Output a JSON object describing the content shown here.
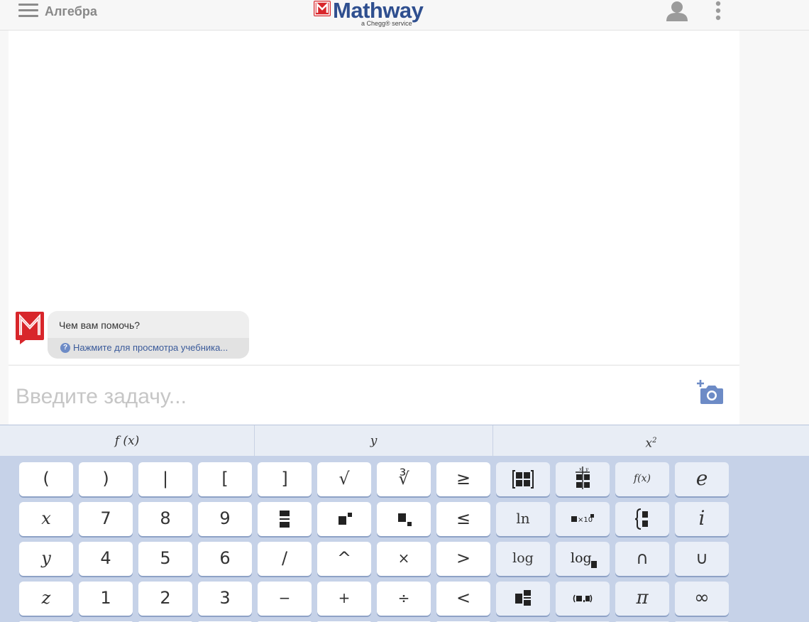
{
  "header": {
    "subject": "Алгебра",
    "logo_text": "Mathway",
    "logo_sub": "a Chegg® service"
  },
  "chat": {
    "message": "Чем вам помочь?",
    "tutorial_link": "Нажмите для просмотра учебника...",
    "help_glyph": "?"
  },
  "input": {
    "placeholder": "Введите задачу..."
  },
  "keyboard": {
    "tabs": [
      "f(x)",
      "y",
      "x²"
    ],
    "tab_parts": {
      "tab0": "f (x)",
      "tab1": "y",
      "tab2_base": "x",
      "tab2_exp": "2"
    },
    "rows": [
      [
        "(",
        ")",
        "|",
        "[",
        "]",
        "√",
        "∛",
        "≥",
        "matrix-icon",
        "table-icon",
        "f(x)",
        "e"
      ],
      [
        "x",
        "7",
        "8",
        "9",
        "fraction-icon",
        "superscript-icon",
        "subscript-icon",
        "≤",
        "ln",
        "scientific-notation-icon",
        "piecewise-icon",
        "i"
      ],
      [
        "y",
        "4",
        "5",
        "6",
        "/",
        "^",
        "×",
        ">",
        "log",
        "log-base-icon",
        "∩",
        "∪"
      ],
      [
        "z",
        "1",
        "2",
        "3",
        "−",
        "+",
        "÷",
        "<",
        "mixed-number-icon",
        "ordered-pair-icon",
        "π",
        "∞"
      ]
    ],
    "labels": {
      "r0": [
        "(",
        ")",
        "|",
        "[",
        "]",
        "√",
        "∛",
        "≥",
        "",
        "",
        "f(x)",
        "e"
      ],
      "r1": [
        "x",
        "7",
        "8",
        "9",
        "",
        "",
        "",
        "≤",
        "ln",
        "",
        "",
        "i"
      ],
      "r2": [
        "y",
        "4",
        "5",
        "6",
        "/",
        "^",
        "×",
        ">",
        "log",
        "log",
        "∩",
        "∪"
      ],
      "r3": [
        "z",
        "1",
        "2",
        "3",
        "−",
        "+",
        "÷",
        "<",
        "",
        "",
        "π",
        "∞"
      ]
    },
    "mini_labels": {
      "table_x": "x",
      "table_y": "y",
      "sci": "×10"
    }
  },
  "colors": {
    "keyboard_bg": "#c6d2e8",
    "tab_bg": "#e8edf5",
    "logo_blue": "#2f4f8f",
    "logo_red": "#d8262b",
    "camera_blue": "#6d8bc6"
  }
}
